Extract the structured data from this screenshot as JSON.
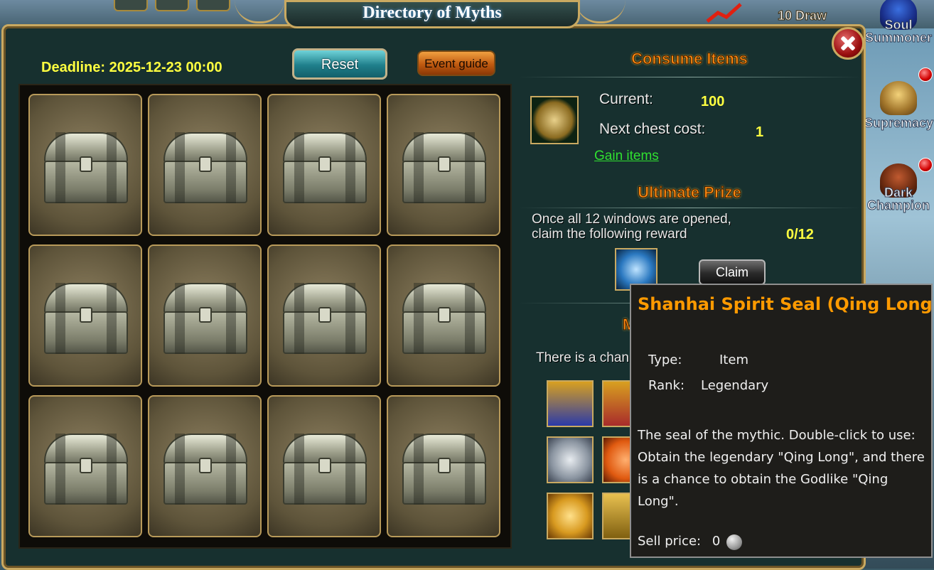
{
  "window": {
    "title": "Directory of Myths",
    "deadline": "Deadline: 2025-12-23 00:00",
    "reset_label": "Reset",
    "guide_label": "Event guide"
  },
  "side_menu": [
    {
      "label": "Soul\nSummoner"
    },
    {
      "label": "Supremacy"
    },
    {
      "label": "Dark\nChampion"
    }
  ],
  "top_bar": {
    "draw_label": "10 Draw"
  },
  "grid": {
    "chests": [
      {
        "state": "closed"
      },
      {
        "state": "closed"
      },
      {
        "state": "closed"
      },
      {
        "state": "closed"
      },
      {
        "state": "closed"
      },
      {
        "state": "closed"
      },
      {
        "state": "closed"
      },
      {
        "state": "closed"
      },
      {
        "state": "closed"
      },
      {
        "state": "closed"
      },
      {
        "state": "closed"
      },
      {
        "state": "closed"
      }
    ]
  },
  "consume": {
    "title": "Consume Items",
    "current_label": "Current:",
    "current_value": "100",
    "next_label": "Next chest cost:",
    "next_value": "1",
    "gain_label": "Gain items"
  },
  "ultimate": {
    "title": "Ultimate Prize",
    "desc_line1": "Once all 12 windows are opened,",
    "desc_line2": "claim the following reward",
    "progress": "0/12",
    "claim_label": "Claim"
  },
  "rewards": {
    "title_partial": "M",
    "desc_partial": "There is a chan",
    "items": [
      {
        "icon": "treasure-chest-blue-icon",
        "color": "#2b3aa8"
      },
      {
        "icon": "treasure-chest-red-icon",
        "color": "#a82b2b"
      },
      {
        "icon": "silver-coin-icon",
        "color": "#9fa6b0"
      },
      {
        "icon": "orange-gem-icon",
        "color": "#e05a10"
      },
      {
        "icon": "gold-ring-icon",
        "color": "#d89a20"
      },
      {
        "icon": "book-icon",
        "color": "#c9a030"
      }
    ]
  },
  "tooltip": {
    "title": "Shanhai Spirit Seal (Qing Long)",
    "type_label": "Type:",
    "type_value": "Item",
    "rank_label": "Rank:",
    "rank_value": "Legendary",
    "description": "The seal of the mythic. Double-click to use: Obtain the legendary \"Qing Long\", and there is a chance to obtain the Godlike \"Qing Long\".",
    "sell_label": "Sell price:",
    "sell_value": "0"
  }
}
